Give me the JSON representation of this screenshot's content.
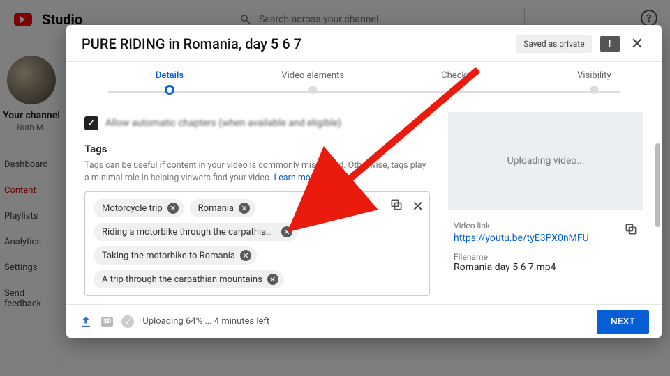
{
  "bg": {
    "brand": "Studio",
    "search_placeholder": "Search across your channel",
    "channel_heading": "Your channel",
    "author_name": "Ruth M.",
    "nav": [
      "Dashboard",
      "Content",
      "Playlists",
      "Analytics",
      "Settings",
      "Send feedback"
    ],
    "nav_active_index": 1
  },
  "dialog": {
    "title": "PURE RIDING in Romania, day 5 6 7",
    "saved_label": "Saved as private",
    "feedback_mark": "!",
    "steps": [
      "Details",
      "Video elements",
      "Checks",
      "Visibility"
    ],
    "active_step_index": 0,
    "chapters_label": "Allow automatic chapters (when available and eligible)",
    "tags_heading": "Tags",
    "tags_help": "Tags can be useful if content in your video is commonly misspelled. Otherwise, tags play a minimal role in helping viewers find your video. ",
    "tags_learn_more": "Learn more",
    "tags": [
      "Motorcycle trip",
      "Romania",
      "Riding a motorbike through the carpathian moun...",
      "Taking the motorbike to Romania",
      "A trip through the carpathian mountains"
    ],
    "preview_status": "Uploading video...",
    "video_link_label": "Video link",
    "video_link": "https://youtu.be/tyE3PX0nMFU",
    "filename_label": "Filename",
    "filename": "Romania day 5 6 7.mp4",
    "upload_status": "Uploading 64% ... 4 minutes left",
    "sd_label": "SD",
    "next_label": "NEXT"
  }
}
